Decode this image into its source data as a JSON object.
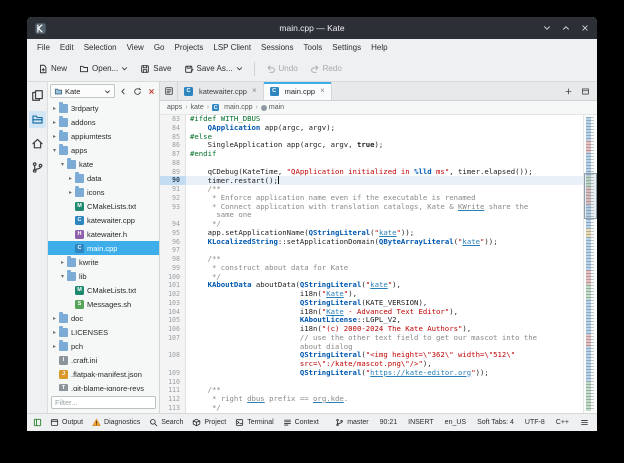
{
  "window": {
    "title": "main.cpp — Kate"
  },
  "menubar": [
    "File",
    "Edit",
    "Selection",
    "View",
    "Go",
    "Projects",
    "LSP Client",
    "Sessions",
    "Tools",
    "Settings",
    "Help"
  ],
  "toolbar": [
    {
      "label": "New",
      "icon": "new-document-icon"
    },
    {
      "label": "Open...",
      "icon": "open-folder-icon",
      "dropdown": true
    },
    {
      "label": "Save",
      "icon": "save-icon"
    },
    {
      "label": "Save As...",
      "icon": "save-as-icon",
      "dropdown": true
    },
    {
      "label": "Undo",
      "icon": "undo-icon",
      "disabled": true
    },
    {
      "label": "Redo",
      "icon": "redo-icon",
      "disabled": true
    }
  ],
  "dock": [
    {
      "name": "documents",
      "icon": "documents-icon"
    },
    {
      "name": "projects",
      "icon": "projects-icon",
      "active": true
    },
    {
      "name": "filesystem-browser",
      "icon": "filesystem-browser-icon"
    },
    {
      "name": "git",
      "icon": "git-icon"
    }
  ],
  "project": {
    "name": "Kate",
    "filter_placeholder": "Filter...",
    "file_icons": {
      "cpp": {
        "letter": "C",
        "color": "#2e86c1"
      },
      "h": {
        "letter": "H",
        "color": "#8e61ad"
      },
      "cmake": {
        "letter": "M",
        "color": "#1d8a70"
      },
      "sh": {
        "letter": "S",
        "color": "#58a35a"
      },
      "json": {
        "letter": "J",
        "color": "#d99a2b"
      },
      "ini": {
        "letter": "I",
        "color": "#8d9499"
      },
      "txt": {
        "letter": "T",
        "color": "#8d9499"
      }
    },
    "tree": [
      {
        "d": 0,
        "a": "c",
        "t": "folder",
        "label": "3rdparty"
      },
      {
        "d": 0,
        "a": "c",
        "t": "folder",
        "label": "addons"
      },
      {
        "d": 0,
        "a": "c",
        "t": "folder",
        "label": "appiumtests"
      },
      {
        "d": 0,
        "a": "e",
        "t": "folder",
        "label": "apps"
      },
      {
        "d": 1,
        "a": "e",
        "t": "folder",
        "label": "kate"
      },
      {
        "d": 2,
        "a": "c",
        "t": "folder",
        "label": "data"
      },
      {
        "d": 2,
        "a": "c",
        "t": "folder",
        "label": "icons"
      },
      {
        "d": 2,
        "a": "",
        "t": "cmake",
        "label": "CMakeLists.txt"
      },
      {
        "d": 2,
        "a": "",
        "t": "cpp",
        "label": "katewaiter.cpp"
      },
      {
        "d": 2,
        "a": "",
        "t": "h",
        "label": "katewaiter.h"
      },
      {
        "d": 2,
        "a": "",
        "t": "cpp",
        "label": "main.cpp",
        "selected": true
      },
      {
        "d": 1,
        "a": "c",
        "t": "folder",
        "label": "kwrite"
      },
      {
        "d": 1,
        "a": "e",
        "t": "folder",
        "label": "lib"
      },
      {
        "d": 2,
        "a": "",
        "t": "cmake",
        "label": "CMakeLists.txt"
      },
      {
        "d": 2,
        "a": "",
        "t": "sh",
        "label": "Messages.sh"
      },
      {
        "d": 0,
        "a": "c",
        "t": "folder",
        "label": "doc"
      },
      {
        "d": 0,
        "a": "c",
        "t": "folder",
        "label": "LICENSES"
      },
      {
        "d": 0,
        "a": "c",
        "t": "folder",
        "label": "pch"
      },
      {
        "d": 0,
        "a": "",
        "t": "ini",
        "label": ".craft.ini"
      },
      {
        "d": 0,
        "a": "",
        "t": "json",
        "label": ".flatpak-manifest.json"
      },
      {
        "d": 0,
        "a": "",
        "t": "txt",
        "label": ".git-blame-ignore-revs"
      }
    ]
  },
  "tabs": [
    {
      "label": "katewaiter.cpp",
      "type": "cpp"
    },
    {
      "label": "main.cpp",
      "type": "cpp",
      "active": true
    }
  ],
  "breadcrumb": [
    {
      "label": "apps",
      "type": "text"
    },
    {
      "label": "kate",
      "type": "text"
    },
    {
      "label": "main.cpp",
      "type": "cpp"
    },
    {
      "label": "main",
      "type": "symbol"
    }
  ],
  "editor": {
    "rows": [
      {
        "n": "83",
        "seg": [
          [
            "pp",
            "#ifdef WITH_DBUS"
          ]
        ]
      },
      {
        "n": "84",
        "seg": [
          [
            "p",
            "    "
          ],
          [
            "t",
            "QApplication"
          ],
          [
            "p",
            " app(argc, argv);"
          ]
        ]
      },
      {
        "n": "85",
        "seg": [
          [
            "pp",
            "#else"
          ]
        ]
      },
      {
        "n": "86",
        "seg": [
          [
            "p",
            "    SingleApplication app(argc, argv, "
          ],
          [
            "k",
            "true"
          ],
          [
            "p",
            ");"
          ]
        ]
      },
      {
        "n": "87",
        "seg": [
          [
            "pp",
            "#endif"
          ]
        ]
      },
      {
        "n": "88",
        "seg": []
      },
      {
        "n": "89",
        "seg": [
          [
            "p",
            "    qCDebug(KateTime, "
          ],
          [
            "s",
            "\"QApplication initialized in "
          ],
          [
            "sc",
            "%lld"
          ],
          [
            "s",
            " ms\""
          ],
          [
            "p",
            ", timer.elapsed());"
          ]
        ]
      },
      {
        "n": "90",
        "cur": true,
        "seg": [
          [
            "p",
            "    timer.restart();"
          ]
        ]
      },
      {
        "n": "91",
        "seg": [
          [
            "c",
            "    /**"
          ]
        ]
      },
      {
        "n": "92",
        "seg": [
          [
            "c",
            "     * Enforce application name even if the executable is renamed"
          ]
        ]
      },
      {
        "n": "93",
        "seg": [
          [
            "c",
            "     * Connect application with translation catalogs, Kate & "
          ],
          [
            "cu",
            "KWrite"
          ],
          [
            "c",
            " share the"
          ]
        ]
      },
      {
        "n": "",
        "seg": [
          [
            "c",
            "      same one"
          ]
        ]
      },
      {
        "n": "94",
        "seg": [
          [
            "c",
            "     */"
          ]
        ]
      },
      {
        "n": "95",
        "seg": [
          [
            "p",
            "    app.setApplicationName("
          ],
          [
            "t",
            "QStringLiteral"
          ],
          [
            "p",
            "("
          ],
          [
            "s",
            "\""
          ],
          [
            "su",
            "kate"
          ],
          [
            "s",
            "\""
          ],
          [
            "p",
            "));"
          ]
        ]
      },
      {
        "n": "96",
        "seg": [
          [
            "p",
            "    "
          ],
          [
            "t",
            "KLocalizedString"
          ],
          [
            "p",
            "::setApplicationDomain("
          ],
          [
            "t",
            "QByteArrayLiteral"
          ],
          [
            "p",
            "("
          ],
          [
            "s",
            "\""
          ],
          [
            "su",
            "kate"
          ],
          [
            "s",
            "\""
          ],
          [
            "p",
            "));"
          ]
        ]
      },
      {
        "n": "97",
        "seg": []
      },
      {
        "n": "98",
        "seg": [
          [
            "c",
            "    /**"
          ]
        ]
      },
      {
        "n": "99",
        "seg": [
          [
            "c",
            "     * construct about data for Kate"
          ]
        ]
      },
      {
        "n": "100",
        "seg": [
          [
            "c",
            "     */"
          ]
        ]
      },
      {
        "n": "101",
        "seg": [
          [
            "p",
            "    "
          ],
          [
            "t",
            "KAboutData"
          ],
          [
            "p",
            " aboutData("
          ],
          [
            "t",
            "QStringLiteral"
          ],
          [
            "p",
            "("
          ],
          [
            "s",
            "\""
          ],
          [
            "su",
            "kate"
          ],
          [
            "s",
            "\""
          ],
          [
            "p",
            "),"
          ]
        ]
      },
      {
        "n": "102",
        "seg": [
          [
            "p",
            "                         i18n("
          ],
          [
            "s",
            "\""
          ],
          [
            "su",
            "Kate"
          ],
          [
            "s",
            "\""
          ],
          [
            "p",
            "),"
          ]
        ]
      },
      {
        "n": "103",
        "seg": [
          [
            "p",
            "                         "
          ],
          [
            "t",
            "QStringLiteral"
          ],
          [
            "p",
            "(KATE_VERSION),"
          ]
        ]
      },
      {
        "n": "104",
        "seg": [
          [
            "p",
            "                         i18n("
          ],
          [
            "s",
            "\""
          ],
          [
            "su",
            "Kate"
          ],
          [
            "s",
            " - Advanced Text Editor\""
          ],
          [
            "p",
            "),"
          ]
        ]
      },
      {
        "n": "105",
        "seg": [
          [
            "p",
            "                         "
          ],
          [
            "t",
            "KAboutLicense"
          ],
          [
            "p",
            "::LGPL_V2,"
          ]
        ]
      },
      {
        "n": "106",
        "seg": [
          [
            "p",
            "                         i18n("
          ],
          [
            "s",
            "\"(c) 2000-2024 The Kate Authors\""
          ],
          [
            "p",
            "),"
          ]
        ]
      },
      {
        "n": "107",
        "seg": [
          [
            "p",
            "                         "
          ],
          [
            "c",
            "// use the other text field to get our mascot into the"
          ]
        ]
      },
      {
        "n": "",
        "seg": [
          [
            "c",
            "                         about dialog"
          ]
        ]
      },
      {
        "n": "108",
        "seg": [
          [
            "p",
            "                         "
          ],
          [
            "t",
            "QStringLiteral"
          ],
          [
            "p",
            "("
          ],
          [
            "s",
            "\"<img height=\\\"362\\\" width=\\\"512\\\""
          ]
        ]
      },
      {
        "n": "",
        "seg": [
          [
            "s",
            "                         src=\\\":/kate/mascot.png\\\"/>\""
          ],
          [
            "p",
            "),"
          ]
        ]
      },
      {
        "n": "109",
        "seg": [
          [
            "p",
            "                         "
          ],
          [
            "t",
            "QStringLiteral"
          ],
          [
            "p",
            "("
          ],
          [
            "s",
            "\""
          ],
          [
            "su",
            "https://kate-editor.org"
          ],
          [
            "s",
            "\""
          ],
          [
            "p",
            "));"
          ]
        ]
      },
      {
        "n": "110",
        "seg": []
      },
      {
        "n": "111",
        "seg": [
          [
            "c",
            "    /**"
          ]
        ]
      },
      {
        "n": "112",
        "seg": [
          [
            "c",
            "     * right "
          ],
          [
            "cu",
            "dbus"
          ],
          [
            "c",
            " prefix == "
          ],
          [
            "cu",
            "org.kde"
          ],
          [
            "c",
            "."
          ]
        ]
      },
      {
        "n": "113",
        "seg": [
          [
            "c",
            "     */"
          ]
        ]
      }
    ]
  },
  "statusbar": {
    "toolviews": [
      {
        "label": "Output",
        "icon": "output-icon"
      },
      {
        "label": "Diagnostics",
        "icon": "diagnostics-icon"
      },
      {
        "label": "Search",
        "icon": "search-icon"
      },
      {
        "label": "Project",
        "icon": "project-box-icon"
      },
      {
        "label": "Terminal",
        "icon": "terminal-icon"
      },
      {
        "label": "Context",
        "icon": "context-icon"
      }
    ],
    "branch": "master",
    "cursor": "90:21",
    "mode": "INSERT",
    "dictionary": "en_US",
    "tab_mode": "Soft Tabs: 4",
    "encoding": "UTF-8",
    "syntax": "C++"
  }
}
